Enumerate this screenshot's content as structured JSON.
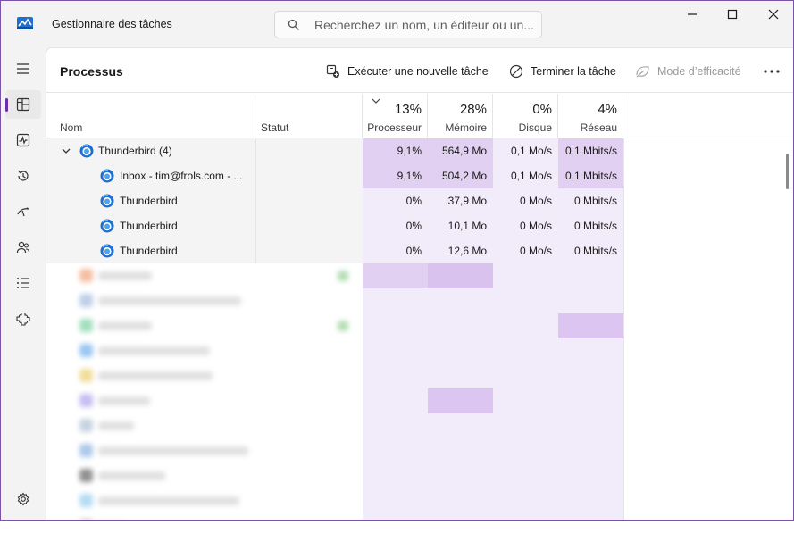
{
  "app": {
    "title": "Gestionnaire des tâches"
  },
  "search": {
    "placeholder": "Recherchez un nom, un éditeur ou un..."
  },
  "toolbar": {
    "title": "Processus",
    "run_task": "Exécuter une nouvelle tâche",
    "end_task": "Terminer la tâche",
    "efficiency": "Mode d’efficacité"
  },
  "columns": {
    "name": "Nom",
    "status": "Statut",
    "cpu": {
      "percent": "13%",
      "label": "Processeur"
    },
    "memory": {
      "percent": "28%",
      "label": "Mémoire"
    },
    "disk": {
      "percent": "0%",
      "label": "Disque"
    },
    "network": {
      "percent": "4%",
      "label": "Réseau"
    }
  },
  "processes": [
    {
      "name": "Thunderbird (4)",
      "cpu": "9,1%",
      "memory": "564,9 Mo",
      "disk": "0,1 Mo/s",
      "network": "0,1 Mbits/s"
    },
    {
      "name": "Inbox - tim@frols.com - ...",
      "cpu": "9,1%",
      "memory": "504,2 Mo",
      "disk": "0,1 Mo/s",
      "network": "0,1 Mbits/s"
    },
    {
      "name": "Thunderbird",
      "cpu": "0%",
      "memory": "37,9 Mo",
      "disk": "0 Mo/s",
      "network": "0 Mbits/s"
    },
    {
      "name": "Thunderbird",
      "cpu": "0%",
      "memory": "10,1 Mo",
      "disk": "0 Mo/s",
      "network": "0 Mbits/s"
    },
    {
      "name": "Thunderbird",
      "cpu": "0%",
      "memory": "12,6 Mo",
      "disk": "0 Mo/s",
      "network": "0 Mbits/s"
    }
  ],
  "colors": {
    "accent": "#6b2fa8",
    "heat_high": "#e2d0f2",
    "heat_low": "#f2ebf9",
    "icon_blue": "#1f6fd1"
  },
  "icons": {
    "app": "task-manager-icon",
    "search": "search-icon",
    "nav": [
      "hamburger-menu-icon",
      "processes-icon",
      "performance-icon",
      "app-history-icon",
      "startup-apps-icon",
      "users-icon",
      "details-icon",
      "services-icon",
      "settings-icon"
    ]
  }
}
